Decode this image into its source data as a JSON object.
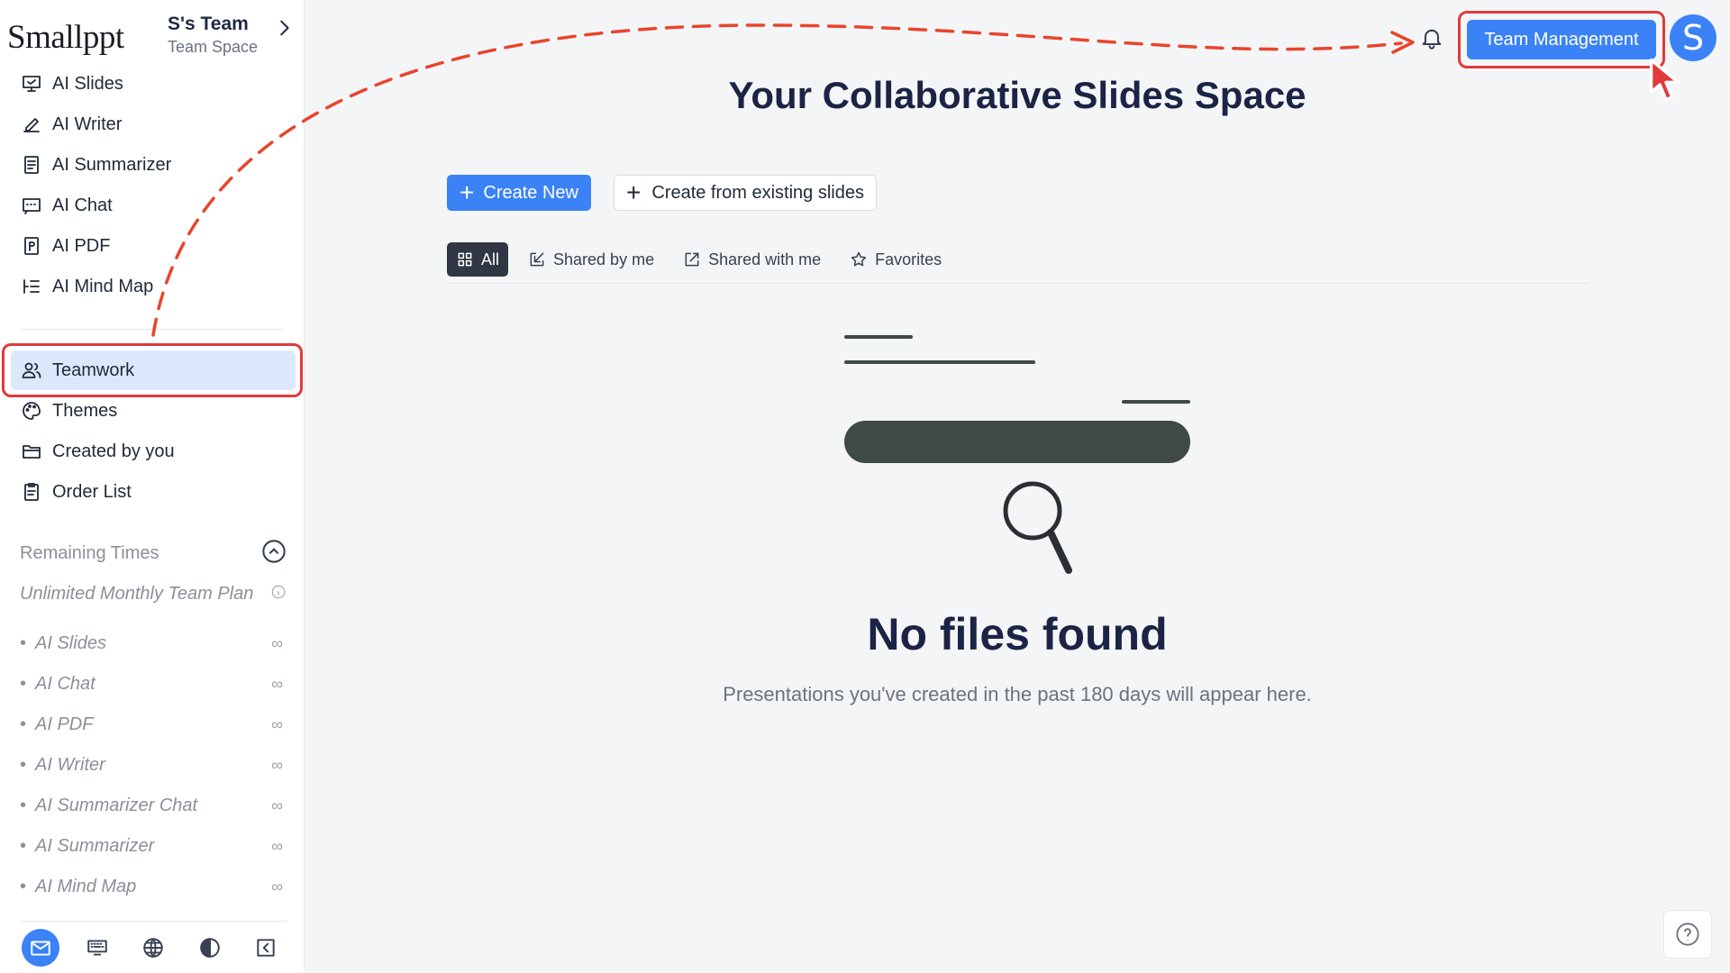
{
  "brand": {
    "logo": "Smallppt",
    "team_name": "S's Team",
    "team_sub": "Team Space"
  },
  "sidebar": {
    "top_items": [
      {
        "label": "AI Slides",
        "icon": "presentation-icon"
      },
      {
        "label": "AI Writer",
        "icon": "pen-icon"
      },
      {
        "label": "AI Summarizer",
        "icon": "document-icon"
      },
      {
        "label": "AI Chat",
        "icon": "chat-icon"
      },
      {
        "label": "AI PDF",
        "icon": "pdf-icon"
      },
      {
        "label": "AI Mind Map",
        "icon": "mindmap-icon"
      }
    ],
    "bottom_items": [
      {
        "label": "Teamwork",
        "icon": "users-icon",
        "active": true
      },
      {
        "label": "Themes",
        "icon": "palette-icon"
      },
      {
        "label": "Created by you",
        "icon": "folder-icon"
      },
      {
        "label": "Order List",
        "icon": "clipboard-icon"
      }
    ],
    "remaining": {
      "title": "Remaining Times",
      "plan": "Unlimited Monthly Team Plan",
      "items": [
        {
          "label": "AI Slides",
          "value": "∞"
        },
        {
          "label": "AI Chat",
          "value": "∞"
        },
        {
          "label": "AI PDF",
          "value": "∞"
        },
        {
          "label": "AI Writer",
          "value": "∞"
        },
        {
          "label": "AI Summarizer Chat",
          "value": "∞"
        },
        {
          "label": "AI Summarizer",
          "value": "∞"
        },
        {
          "label": "AI Mind Map",
          "value": "∞"
        }
      ]
    },
    "bottom_bar": [
      "mail-icon",
      "keyboard-icon",
      "globe-icon",
      "contrast-icon",
      "collapse-icon"
    ]
  },
  "header": {
    "team_management": "Team Management",
    "avatar_letter": "S"
  },
  "main": {
    "title": "Your Collaborative Slides Space",
    "create_new": "Create New",
    "create_existing": "Create from existing slides",
    "tabs": [
      {
        "label": "All",
        "icon": "grid-icon",
        "active": true
      },
      {
        "label": "Shared by me",
        "icon": "share-out-icon"
      },
      {
        "label": "Shared with me",
        "icon": "external-link-icon"
      },
      {
        "label": "Favorites",
        "icon": "star-icon"
      }
    ],
    "empty_title": "No files found",
    "empty_sub": "Presentations you've created in the past 180 days will appear here."
  },
  "colors": {
    "accent": "#3b82f6",
    "annotation": "#e03a3a",
    "heading": "#1b2444"
  }
}
